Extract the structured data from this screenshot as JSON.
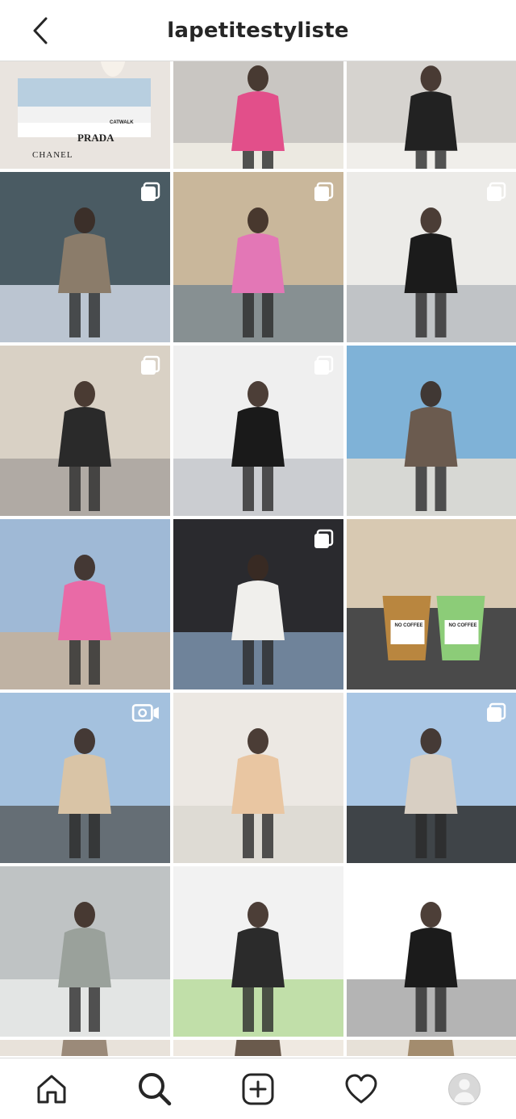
{
  "header": {
    "username": "lapetitestyliste",
    "back_icon": "chevron-left-icon"
  },
  "grid": {
    "columns": 3,
    "tiles": [
      {
        "id": "post-1",
        "kind": "photo",
        "palette": [
          "#e9e4df",
          "#f3efe9",
          "#bfb8b0"
        ],
        "book_title_1": "PRADA",
        "book_title_1_sub": "CATWALK",
        "book_title_2": "CHANEL"
      },
      {
        "id": "post-2",
        "kind": "photo",
        "palette": [
          "#c9c6c2",
          "#e24f8a",
          "#f2eee6"
        ]
      },
      {
        "id": "post-3",
        "kind": "photo",
        "palette": [
          "#d6d3cf",
          "#222222",
          "#f4f2ef"
        ]
      },
      {
        "id": "post-4",
        "kind": "carousel",
        "palette": [
          "#4a5b63",
          "#8b7c6a",
          "#cfd8e4"
        ]
      },
      {
        "id": "post-5",
        "kind": "carousel",
        "palette": [
          "#c9b79b",
          "#e377b6",
          "#7b8a91"
        ]
      },
      {
        "id": "post-6",
        "kind": "carousel",
        "palette": [
          "#ecebe8",
          "#1b1b1b",
          "#b8bcc0"
        ]
      },
      {
        "id": "post-7",
        "kind": "carousel",
        "palette": [
          "#d9d1c5",
          "#2a2a2a",
          "#a8a39d"
        ]
      },
      {
        "id": "post-8",
        "kind": "carousel",
        "palette": [
          "#efefef",
          "#1a1a1a",
          "#c4c7cb"
        ]
      },
      {
        "id": "post-9",
        "kind": "photo",
        "palette": [
          "#7fb2d7",
          "#6b5b4f",
          "#e6ded4"
        ]
      },
      {
        "id": "post-10",
        "kind": "photo",
        "palette": [
          "#9fb9d6",
          "#e96aa6",
          "#c4b09a"
        ]
      },
      {
        "id": "post-11",
        "kind": "carousel",
        "palette": [
          "#2a2a2e",
          "#f0efec",
          "#7b93ad"
        ]
      },
      {
        "id": "post-12",
        "kind": "photo",
        "palette": [
          "#d8c9b2",
          "#b9863f",
          "#8ccc78"
        ],
        "cup_label_1": "NO COFFEE",
        "cup_label_2": "NO COFFEE"
      },
      {
        "id": "post-13",
        "kind": "video",
        "palette": [
          "#a4c1de",
          "#d9c4a6",
          "#5a5f63"
        ]
      },
      {
        "id": "post-14",
        "kind": "photo",
        "palette": [
          "#ece8e3",
          "#e9c6a2",
          "#dcd8d1"
        ]
      },
      {
        "id": "post-15",
        "kind": "carousel",
        "palette": [
          "#a9c6e4",
          "#d8cfc3",
          "#2d2d2d"
        ]
      },
      {
        "id": "post-16",
        "kind": "photo",
        "palette": [
          "#bfc3c4",
          "#9aa19b",
          "#e9ebea"
        ]
      },
      {
        "id": "post-17",
        "kind": "photo",
        "palette": [
          "#f2f2f2",
          "#2b2b2b",
          "#b9dc9c"
        ]
      },
      {
        "id": "post-18",
        "kind": "photo",
        "palette": [
          "#ffffff",
          "#1b1b1b",
          "#a7a7a7"
        ]
      },
      {
        "id": "post-19",
        "kind": "photo",
        "palette": [
          "#e8e2da",
          "#9b8a79",
          "#ffffff"
        ]
      },
      {
        "id": "post-20",
        "kind": "photo",
        "palette": [
          "#efe9e1",
          "#6a5a4c",
          "#ffffff"
        ]
      },
      {
        "id": "post-21",
        "kind": "photo",
        "palette": [
          "#e7e1d8",
          "#a38c6e",
          "#ffffff"
        ]
      }
    ]
  },
  "tabbar": {
    "items": [
      {
        "name": "home",
        "icon": "home-icon"
      },
      {
        "name": "search",
        "icon": "search-icon",
        "active": true
      },
      {
        "name": "new-post",
        "icon": "plus-square-icon"
      },
      {
        "name": "activity",
        "icon": "heart-icon"
      },
      {
        "name": "profile",
        "icon": "avatar-icon"
      }
    ]
  },
  "colors": {
    "header_bg": "#ffffff",
    "divider": "#dbdbdb",
    "icon": "#262626",
    "text": "#262626"
  }
}
